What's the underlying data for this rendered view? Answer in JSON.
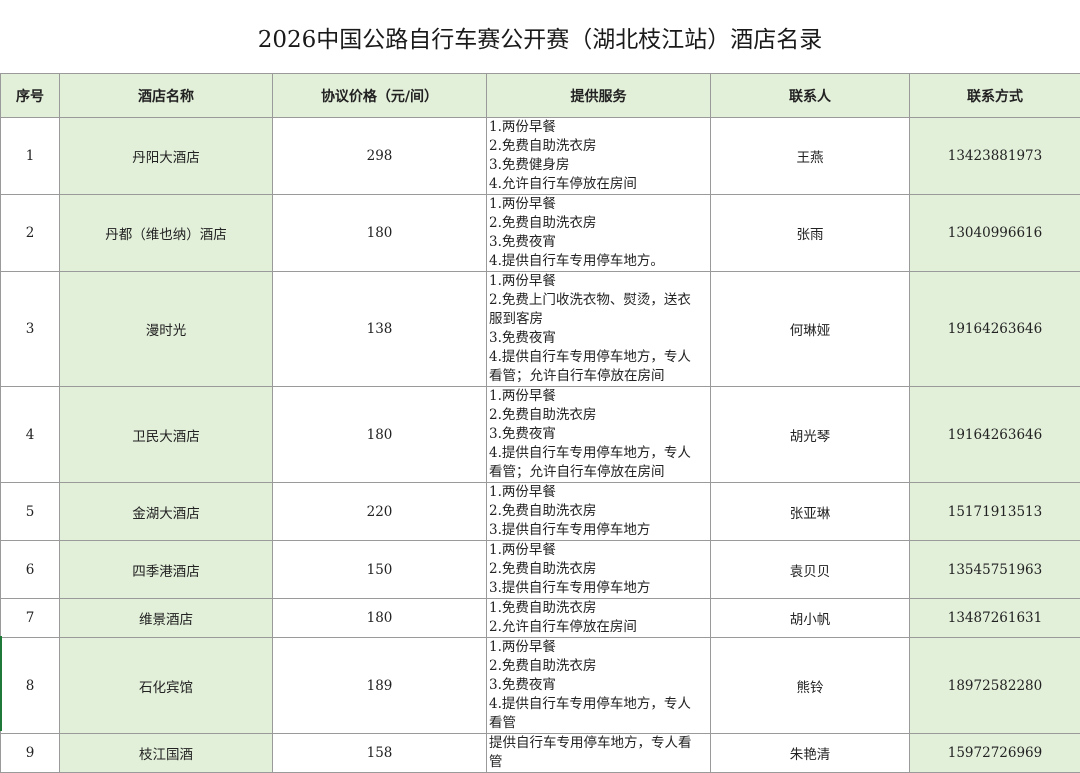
{
  "title": "2026中国公路自行车赛公开赛（湖北枝江站）酒店名录",
  "headers": [
    "序号",
    "酒店名称",
    "协议价格（元/间）",
    "提供服务",
    "联系人",
    "联系方式"
  ],
  "rows": [
    {
      "no": "1",
      "name": "丹阳大酒店",
      "price": "298",
      "services": [
        "1.两份早餐",
        "2.免费自助洗衣房",
        "3.免费健身房",
        "4.允许自行车停放在房间"
      ],
      "contact": "王燕",
      "phone": "13423881973"
    },
    {
      "no": "2",
      "name": "丹都（维也纳）酒店",
      "price": "180",
      "services": [
        "1.两份早餐",
        "2.免费自助洗衣房",
        "3.免费夜宵",
        "4.提供自行车专用停车地方。"
      ],
      "contact": "张雨",
      "phone": "13040996616"
    },
    {
      "no": "3",
      "name": "漫时光",
      "price": "138",
      "services": [
        "1.两份早餐",
        "2.免费上门收洗衣物、熨烫，送衣",
        "服到客房",
        "3.免费夜宵",
        "4.提供自行车专用停车地方，专人",
        "看管；允许自行车停放在房间"
      ],
      "contact": "何琳娅",
      "phone": "19164263646"
    },
    {
      "no": "4",
      "name": "卫民大酒店",
      "price": "180",
      "services": [
        "1.两份早餐",
        "2.免费自助洗衣房",
        "3.免费夜宵",
        "4.提供自行车专用停车地方，专人",
        "看管；允许自行车停放在房间"
      ],
      "contact": "胡光琴",
      "phone": "19164263646"
    },
    {
      "no": "5",
      "name": "金湖大酒店",
      "price": "220",
      "services": [
        "1.两份早餐",
        "2.免费自助洗衣房",
        "3.提供自行车专用停车地方"
      ],
      "contact": "张亚琳",
      "phone": "15171913513"
    },
    {
      "no": "6",
      "name": "四季港酒店",
      "price": "150",
      "services": [
        "1.两份早餐",
        "2.免费自助洗衣房",
        "3.提供自行车专用停车地方"
      ],
      "contact": "袁贝贝",
      "phone": "13545751963"
    },
    {
      "no": "7",
      "name": "维景酒店",
      "price": "180",
      "services": [
        "1.免费自助洗衣房",
        "2.允许自行车停放在房间"
      ],
      "contact": "胡小帆",
      "phone": "13487261631"
    },
    {
      "no": "8",
      "name": "石化宾馆",
      "price": "189",
      "services": [
        "1.两份早餐",
        "2.免费自助洗衣房",
        "3.免费夜宵",
        "4.提供自行车专用停车地方，专人",
        "看管"
      ],
      "contact": "熊铃",
      "phone": "18972582280"
    },
    {
      "no": "9",
      "name": "枝江国酒",
      "price": "158",
      "services": [
        "提供自行车专用停车地方，专人看",
        "管"
      ],
      "contact": "朱艳清",
      "phone": "15972726969"
    }
  ]
}
